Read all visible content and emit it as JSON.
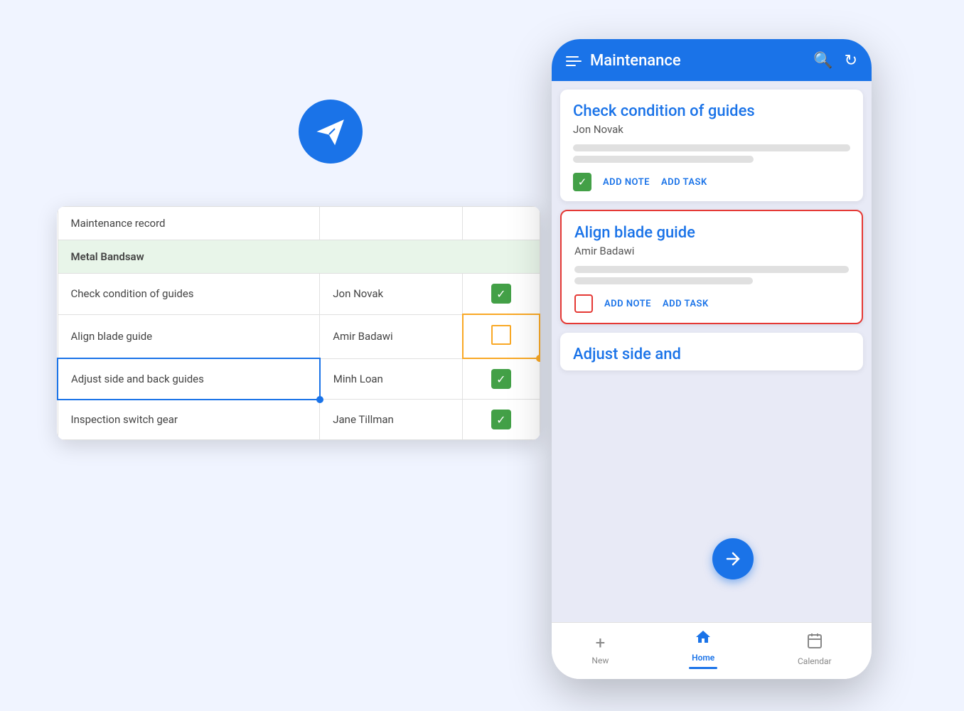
{
  "app": {
    "title": "Maintenance",
    "nav": {
      "new_label": "New",
      "home_label": "Home",
      "calendar_label": "Calendar"
    }
  },
  "spreadsheet": {
    "maintenance_record": "Maintenance record",
    "section_header": "Metal Bandsaw",
    "rows": [
      {
        "task": "Check condition of guides",
        "assignee": "Jon Novak",
        "checked": true,
        "highlight": false
      },
      {
        "task": "Align blade guide",
        "assignee": "Amir Badawi",
        "checked": false,
        "highlight": true,
        "highlight_color": "yellow"
      },
      {
        "task": "Adjust side and back guides",
        "assignee": "Minh Loan",
        "checked": true,
        "highlight": true,
        "highlight_color": "blue"
      },
      {
        "task": "Inspection switch gear",
        "assignee": "Jane Tillman",
        "checked": true,
        "highlight": false
      }
    ]
  },
  "cards": [
    {
      "id": "card1",
      "title": "Check condition of guides",
      "person": "Jon Novak",
      "selected": false,
      "checked": true,
      "add_note": "ADD NOTE",
      "add_task": "ADD TASK"
    },
    {
      "id": "card2",
      "title": "Align blade guide",
      "person": "Amir Badawi",
      "selected": true,
      "checked": false,
      "add_note": "ADD NOTE",
      "add_task": "ADD TASK"
    },
    {
      "id": "card3",
      "title": "Adjust side and",
      "person": "",
      "selected": false,
      "checked": false,
      "partial": true
    }
  ],
  "icons": {
    "search": "⌕",
    "refresh": "↻",
    "checkmark": "✓",
    "home": "⌂",
    "plus": "+",
    "calendar": "▦",
    "arrow_right": "➜",
    "hamburger": "≡"
  }
}
